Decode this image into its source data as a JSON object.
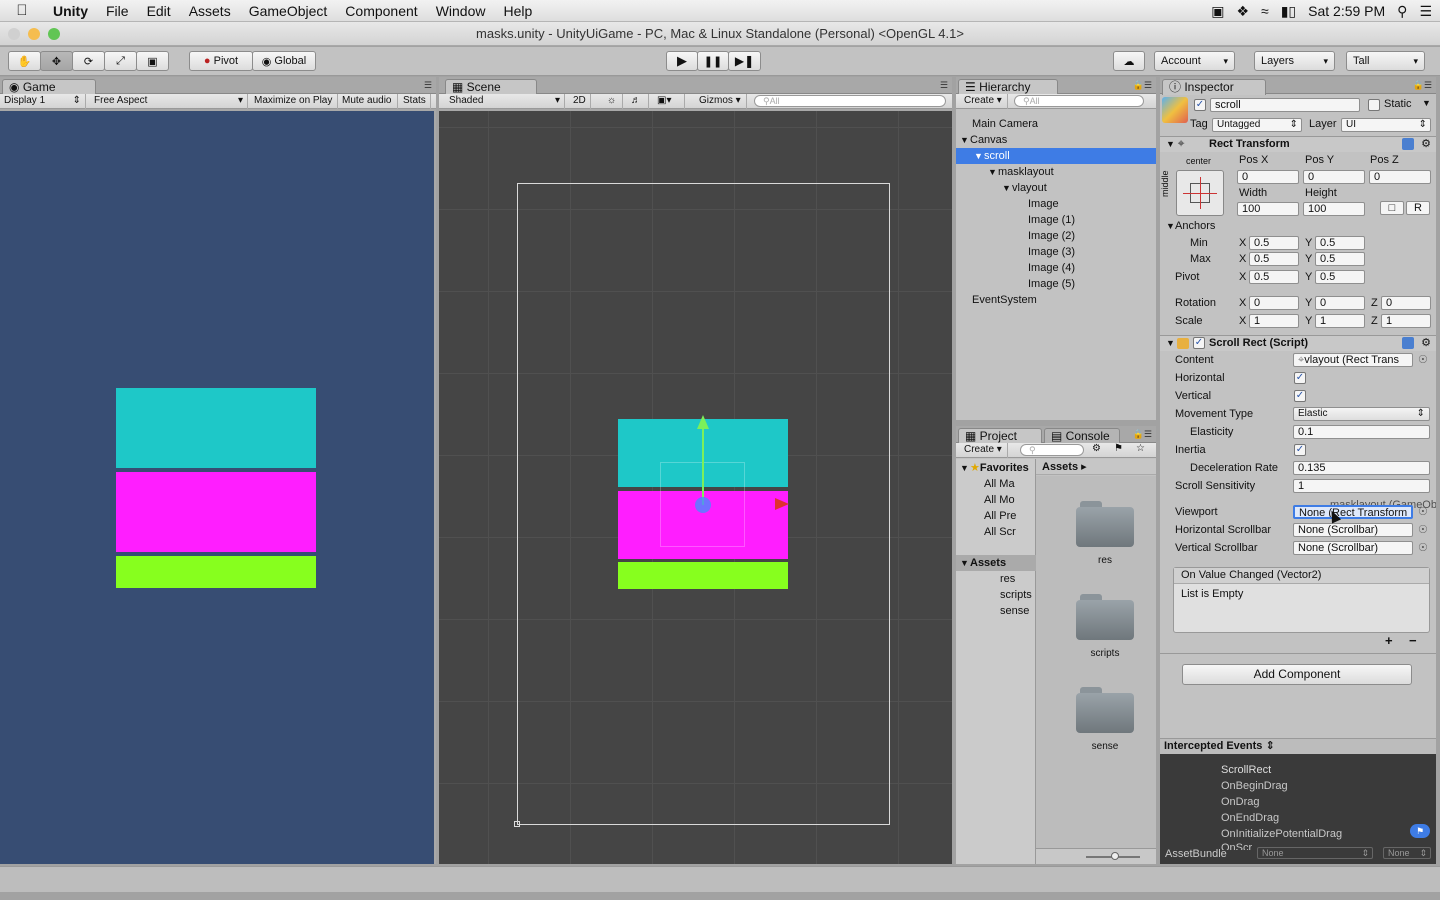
{
  "menubar": {
    "app": "Unity",
    "items": [
      "File",
      "Edit",
      "Assets",
      "GameObject",
      "Component",
      "Window",
      "Help"
    ],
    "clock": "Sat 2:59 PM"
  },
  "window": {
    "title": "masks.unity - UnityUiGame - PC, Mac & Linux Standalone (Personal) <OpenGL 4.1>"
  },
  "toolbar": {
    "pivot": "Pivot",
    "global": "Global",
    "account": "Account",
    "layers": "Layers",
    "layout": "Tall"
  },
  "game": {
    "tab": "Game",
    "display": "Display 1",
    "aspect": "Free Aspect",
    "maximize": "Maximize on Play",
    "mute": "Mute audio",
    "stats": "Stats"
  },
  "scene": {
    "tab": "Scene",
    "shading": "Shaded",
    "mode2d": "2D",
    "gizmos": "Gizmos",
    "search": "All"
  },
  "hierarchy": {
    "tab": "Hierarchy",
    "create": "Create",
    "search": "All",
    "items": [
      "Main Camera",
      "Canvas",
      "scroll",
      "masklayout",
      "vlayout",
      "Image",
      "Image (1)",
      "Image (2)",
      "Image (3)",
      "Image (4)",
      "Image (5)",
      "EventSystem"
    ]
  },
  "project": {
    "tab": "Project",
    "console_tab": "Console",
    "create": "Create",
    "favorites": "Favorites",
    "fav_items": [
      "All Ma",
      "All Mo",
      "All Pre",
      "All Scr"
    ],
    "assets_label": "Assets",
    "tree": [
      "res",
      "scripts",
      "sense"
    ],
    "breadcrumb": "Assets",
    "folders": [
      "res",
      "scripts",
      "sense"
    ]
  },
  "inspector": {
    "tab": "Inspector",
    "name": "scroll",
    "static": "Static",
    "tag_label": "Tag",
    "tag": "Untagged",
    "layer_label": "Layer",
    "layer": "UI",
    "rect": {
      "title": "Rect Transform",
      "anchor_top": "center",
      "anchor_side": "middle",
      "posx_l": "Pos X",
      "posy_l": "Pos Y",
      "posz_l": "Pos Z",
      "posx": "0",
      "posy": "0",
      "posz": "0",
      "w_l": "Width",
      "h_l": "Height",
      "w": "100",
      "h": "100",
      "r_btn": "R",
      "anchors": "Anchors",
      "min": "Min",
      "max": "Max",
      "min_x": "0.5",
      "min_y": "0.5",
      "max_x": "0.5",
      "max_y": "0.5",
      "pivot": "Pivot",
      "pivot_x": "0.5",
      "pivot_y": "0.5",
      "rotation": "Rotation",
      "rot_x": "0",
      "rot_y": "0",
      "rot_z": "0",
      "scale": "Scale",
      "sc_x": "1",
      "sc_y": "1",
      "sc_z": "1",
      "x": "X",
      "y": "Y",
      "z": "Z"
    },
    "scroll": {
      "title": "Scroll Rect (Script)",
      "content_l": "Content",
      "content": "vlayout (Rect Trans",
      "horizontal_l": "Horizontal",
      "vertical_l": "Vertical",
      "movement_l": "Movement Type",
      "movement": "Elastic",
      "elasticity_l": "Elasticity",
      "elasticity": "0.1",
      "inertia_l": "Inertia",
      "decel_l": "Deceleration Rate",
      "decel": "0.135",
      "sens_l": "Scroll Sensitivity",
      "sens": "1",
      "drag_ghost": "masklayout (GameOb",
      "viewport_l": "Viewport",
      "viewport": "None (Rect Transform",
      "hbar_l": "Horizontal Scrollbar",
      "hbar": "None (Scrollbar)",
      "vbar_l": "Vertical Scrollbar",
      "vbar": "None (Scrollbar)",
      "event_title": "On Value Changed (Vector2)",
      "event_empty": "List is Empty"
    },
    "add_component": "Add Component",
    "intercepted": {
      "title": "Intercepted Events",
      "items": [
        "ScrollRect",
        "OnBeginDrag",
        "OnDrag",
        "OnEndDrag",
        "OnInitializePotentialDrag",
        "OnScr"
      ]
    },
    "assetbundle_l": "AssetBundle",
    "ab_none1": "None",
    "ab_none2": "None"
  },
  "colors": {
    "cyan": "#1ec8c8",
    "magenta": "#ff1eff",
    "green": "#87ff1e",
    "selection": "#3e7ce5",
    "game_bg": "#374d73"
  }
}
